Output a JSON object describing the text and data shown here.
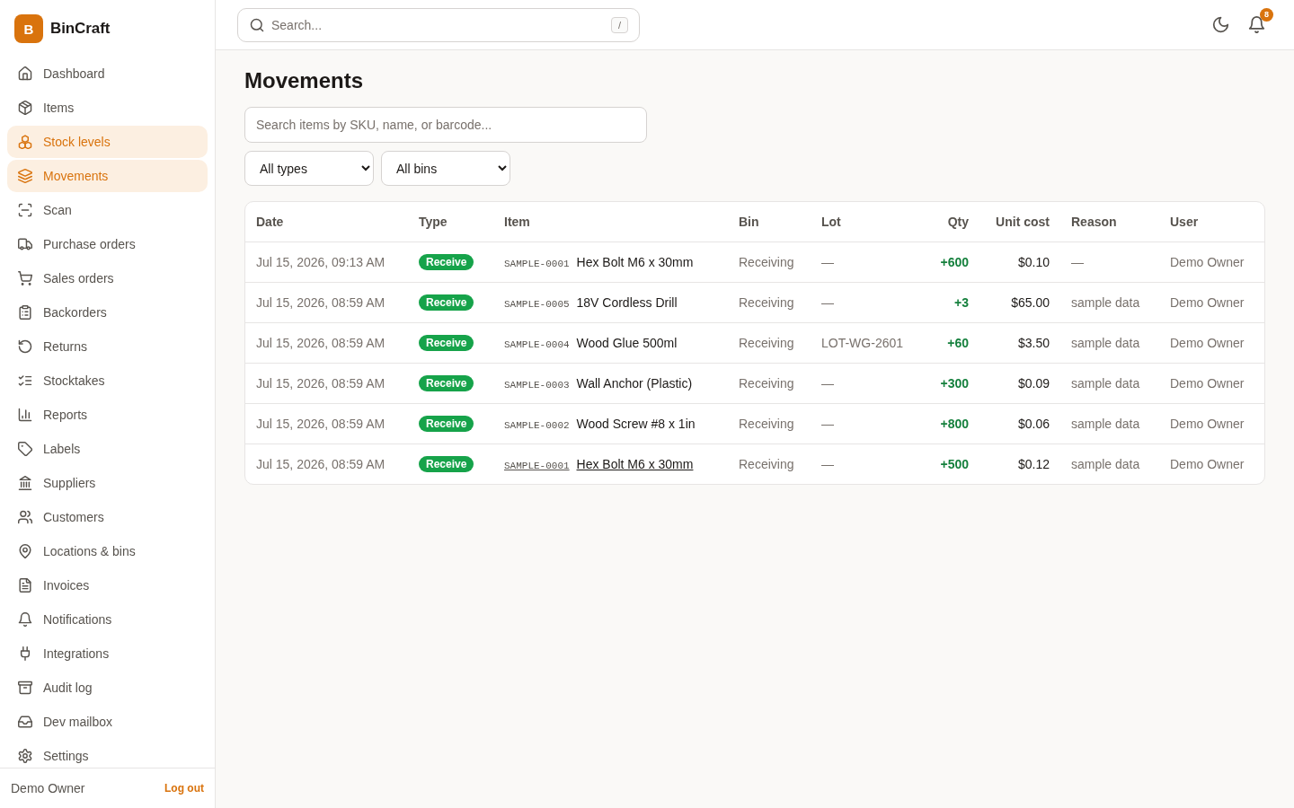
{
  "sidebar": {
    "logo": {
      "mark": "B",
      "name": "BinCraft"
    },
    "items": [
      {
        "label": "Dashboard",
        "selected": false
      },
      {
        "label": "Items",
        "selected": false
      },
      {
        "label": "Stock levels",
        "selected": true
      },
      {
        "label": "Movements",
        "selected": true
      },
      {
        "label": "Scan",
        "selected": false
      },
      {
        "label": "Purchase orders",
        "selected": false
      },
      {
        "label": "Sales orders",
        "selected": false
      },
      {
        "label": "Backorders",
        "selected": false
      },
      {
        "label": "Returns",
        "selected": false
      },
      {
        "label": "Stocktakes",
        "selected": false
      },
      {
        "label": "Reports",
        "selected": false
      },
      {
        "label": "Labels",
        "selected": false
      },
      {
        "label": "Suppliers",
        "selected": false
      },
      {
        "label": "Customers",
        "selected": false
      },
      {
        "label": "Locations & bins",
        "selected": false
      },
      {
        "label": "Invoices",
        "selected": false
      },
      {
        "label": "Notifications",
        "selected": false
      },
      {
        "label": "Integrations",
        "selected": false
      },
      {
        "label": "Audit log",
        "selected": false
      },
      {
        "label": "Dev mailbox",
        "selected": false
      },
      {
        "label": "Settings",
        "selected": false
      }
    ],
    "footer": {
      "user": "Demo Owner",
      "logout": "Log out"
    }
  },
  "topbar": {
    "search": {
      "placeholder": "Search...",
      "shortcut": "/"
    },
    "notifications": {
      "count": "8"
    }
  },
  "page": {
    "title": "Movements",
    "search": {
      "placeholder": "Search items by SKU, name, or barcode..."
    },
    "filters": [
      {
        "value": "All types"
      },
      {
        "value": "All bins"
      }
    ]
  },
  "table": {
    "columns": [
      "Date",
      "Type",
      "Item",
      "Bin",
      "Lot",
      "Qty",
      "Unit cost",
      "Reason",
      "User"
    ],
    "rows": [
      {
        "date": "Jul 15, 2026, 09:13 AM",
        "type": "Receive",
        "sku": "SAMPLE-0001",
        "item": "Hex Bolt M6 x 30mm",
        "bin": "Receiving",
        "lot": "—",
        "qty": "+600",
        "unit_cost": "$0.10",
        "reason": "—",
        "user": "Demo Owner",
        "hovered": false
      },
      {
        "date": "Jul 15, 2026, 08:59 AM",
        "type": "Receive",
        "sku": "SAMPLE-0005",
        "item": "18V Cordless Drill",
        "bin": "Receiving",
        "lot": "—",
        "qty": "+3",
        "unit_cost": "$65.00",
        "reason": "sample data",
        "user": "Demo Owner",
        "hovered": false
      },
      {
        "date": "Jul 15, 2026, 08:59 AM",
        "type": "Receive",
        "sku": "SAMPLE-0004",
        "item": "Wood Glue 500ml",
        "bin": "Receiving",
        "lot": "LOT-WG-2601",
        "qty": "+60",
        "unit_cost": "$3.50",
        "reason": "sample data",
        "user": "Demo Owner",
        "hovered": false
      },
      {
        "date": "Jul 15, 2026, 08:59 AM",
        "type": "Receive",
        "sku": "SAMPLE-0003",
        "item": "Wall Anchor (Plastic)",
        "bin": "Receiving",
        "lot": "—",
        "qty": "+300",
        "unit_cost": "$0.09",
        "reason": "sample data",
        "user": "Demo Owner",
        "hovered": false
      },
      {
        "date": "Jul 15, 2026, 08:59 AM",
        "type": "Receive",
        "sku": "SAMPLE-0002",
        "item": "Wood Screw #8 x 1in",
        "bin": "Receiving",
        "lot": "—",
        "qty": "+800",
        "unit_cost": "$0.06",
        "reason": "sample data",
        "user": "Demo Owner",
        "hovered": false
      },
      {
        "date": "Jul 15, 2026, 08:59 AM",
        "type": "Receive",
        "sku": "SAMPLE-0001",
        "item": "Hex Bolt M6 x 30mm",
        "bin": "Receiving",
        "lot": "—",
        "qty": "+500",
        "unit_cost": "$0.12",
        "reason": "sample data",
        "user": "Demo Owner",
        "hovered": true
      }
    ]
  }
}
